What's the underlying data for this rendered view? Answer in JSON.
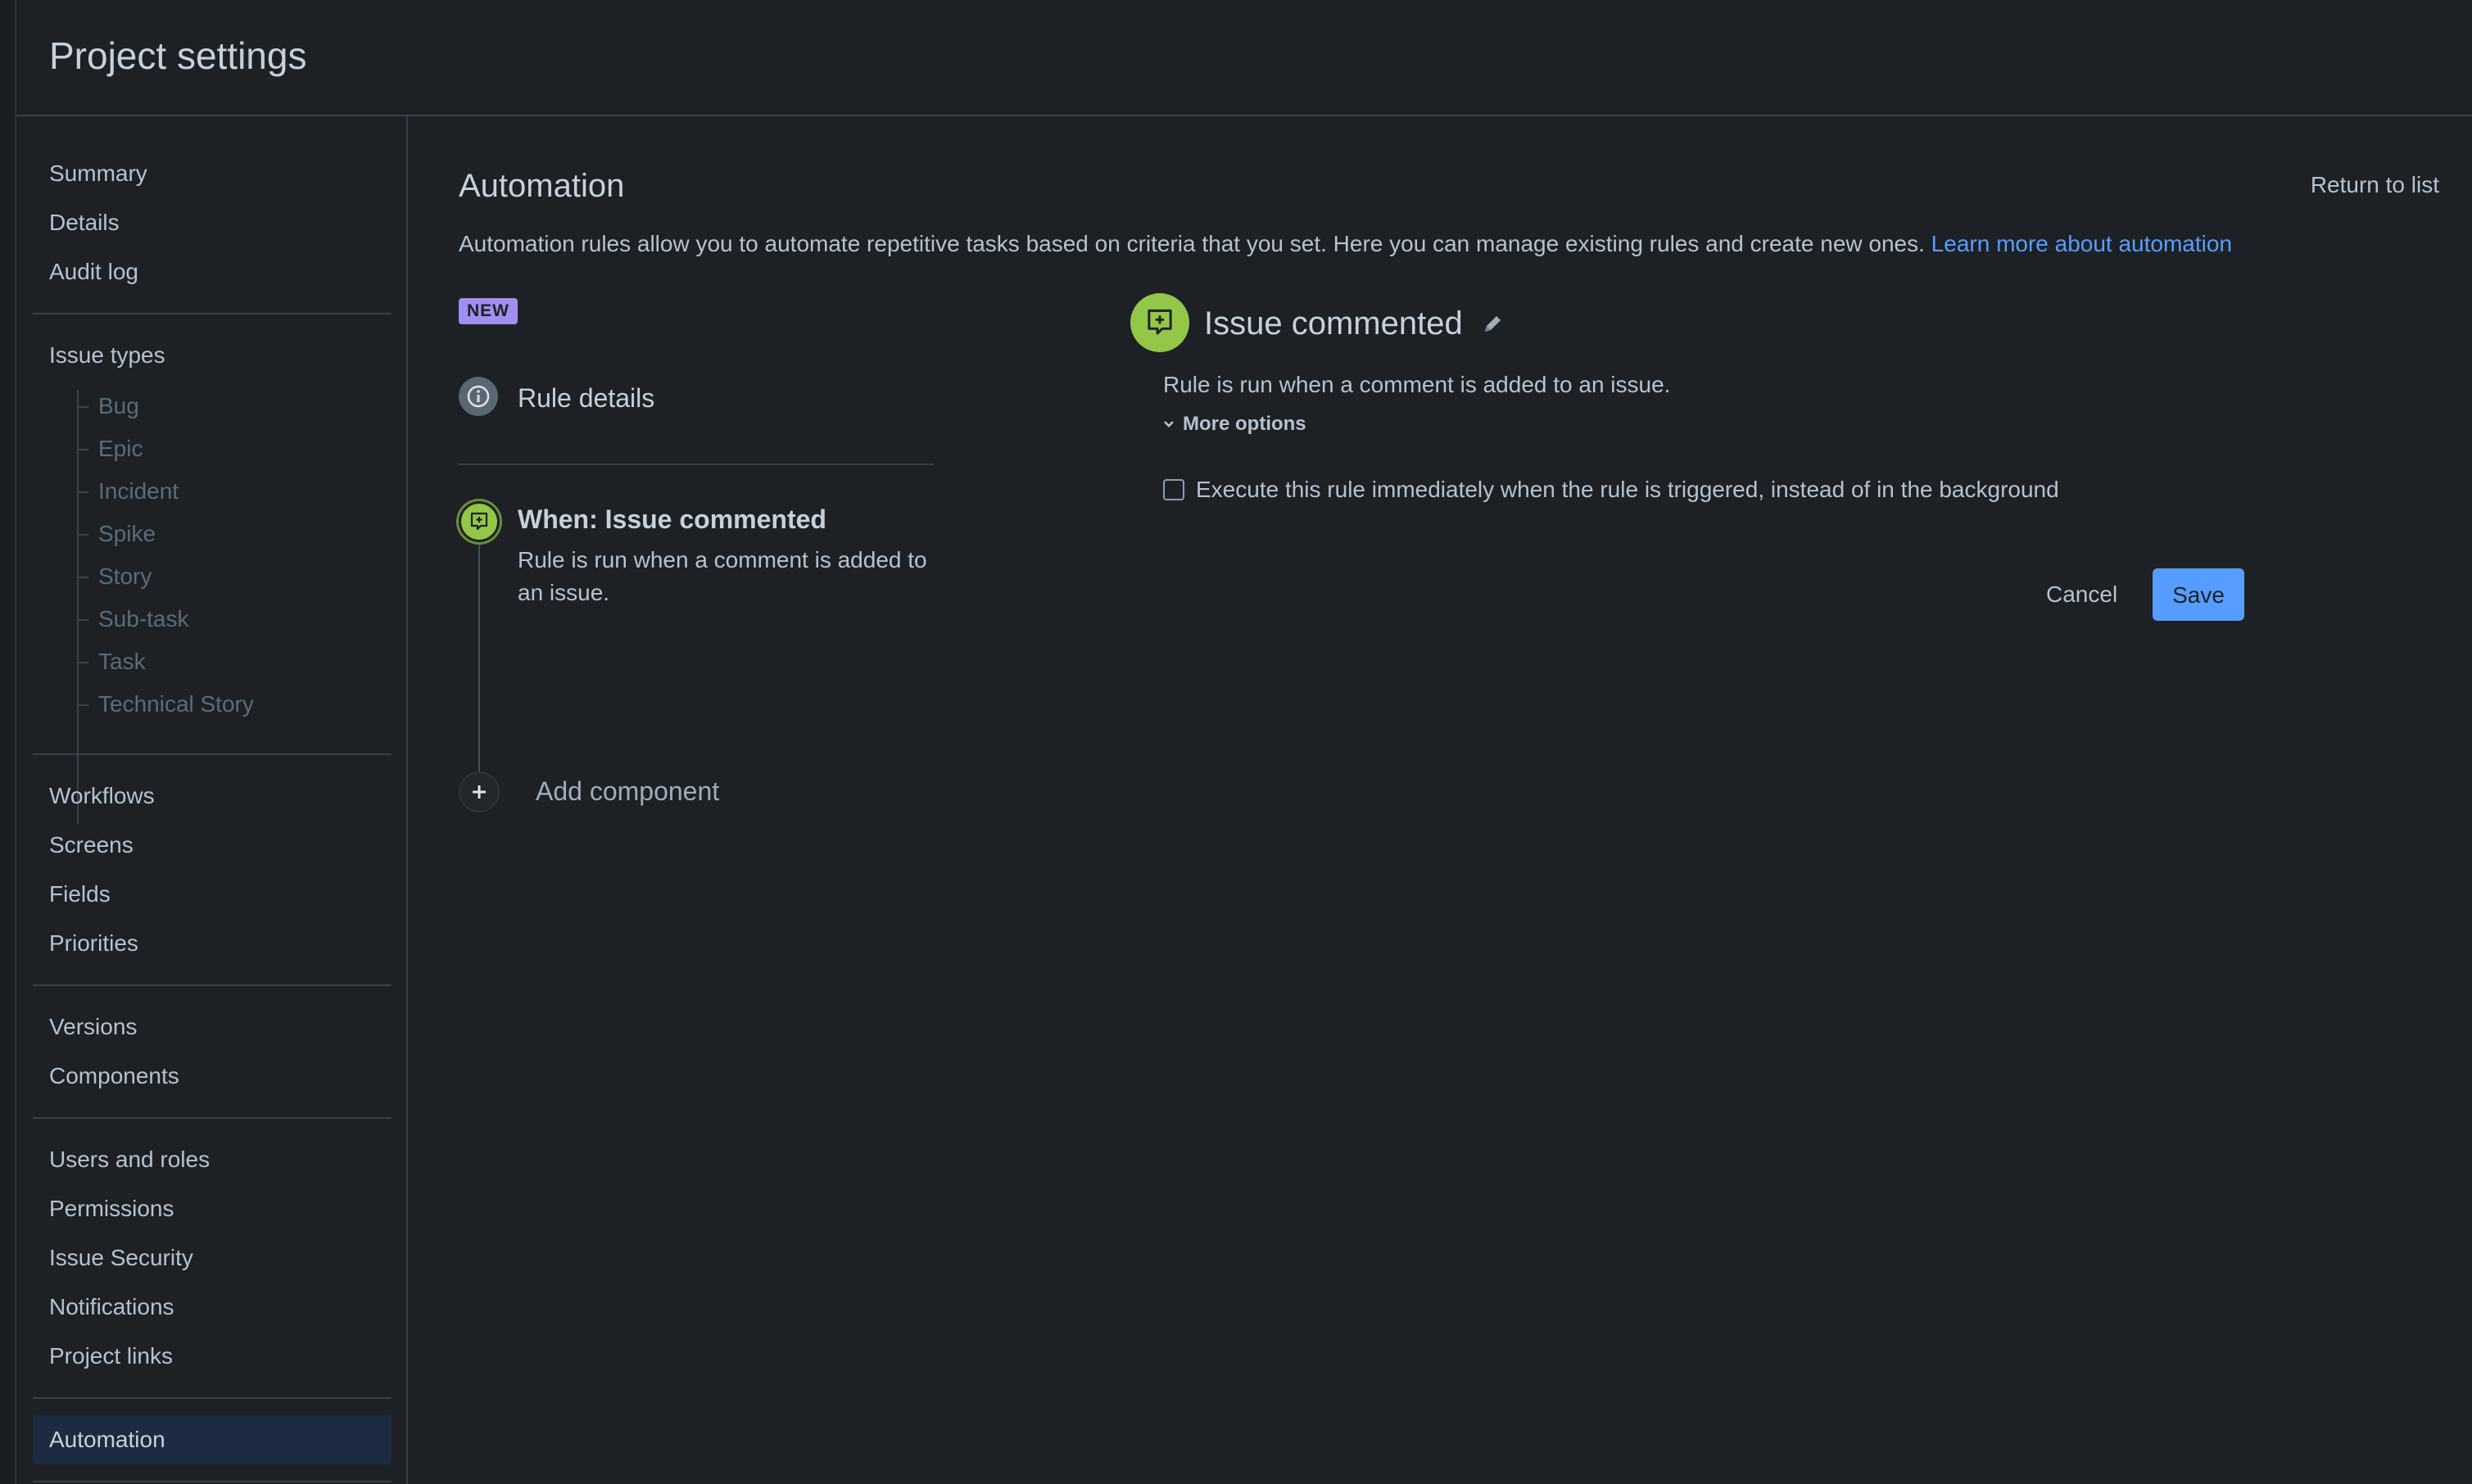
{
  "header": {
    "title": "Project settings"
  },
  "sidebar": {
    "group1": [
      "Summary",
      "Details",
      "Audit log"
    ],
    "issue_types_label": "Issue types",
    "issue_types": [
      "Bug",
      "Epic",
      "Incident",
      "Spike",
      "Story",
      "Sub-task",
      "Task",
      "Technical Story"
    ],
    "group3": [
      "Workflows",
      "Screens",
      "Fields",
      "Priorities"
    ],
    "group4": [
      "Versions",
      "Components"
    ],
    "group5": [
      "Users and roles",
      "Permissions",
      "Issue Security",
      "Notifications",
      "Project links"
    ],
    "active": "Automation"
  },
  "main": {
    "title": "Automation",
    "return_link": "Return to list",
    "description": "Automation rules allow you to automate repetitive tasks based on criteria that you set. Here you can manage existing rules and create new ones.",
    "learn_more": "Learn more about automation",
    "badge": "NEW",
    "rule_details": "Rule details",
    "trigger": {
      "title": "When: Issue commented",
      "description": "Rule is run when a comment is added to an issue."
    },
    "add_component": "Add component"
  },
  "config": {
    "title": "Issue commented",
    "description": "Rule is run when a comment is added to an issue.",
    "more_options": "More options",
    "checkbox_label": "Execute this rule immediately when the rule is triggered, instead of in the background",
    "cancel": "Cancel",
    "save": "Save"
  },
  "colors": {
    "background": "#1d2125",
    "accent": "#579dff",
    "trigger_green": "#94c748",
    "badge_purple": "#9f8fef",
    "active_nav": "#1c2b41"
  }
}
